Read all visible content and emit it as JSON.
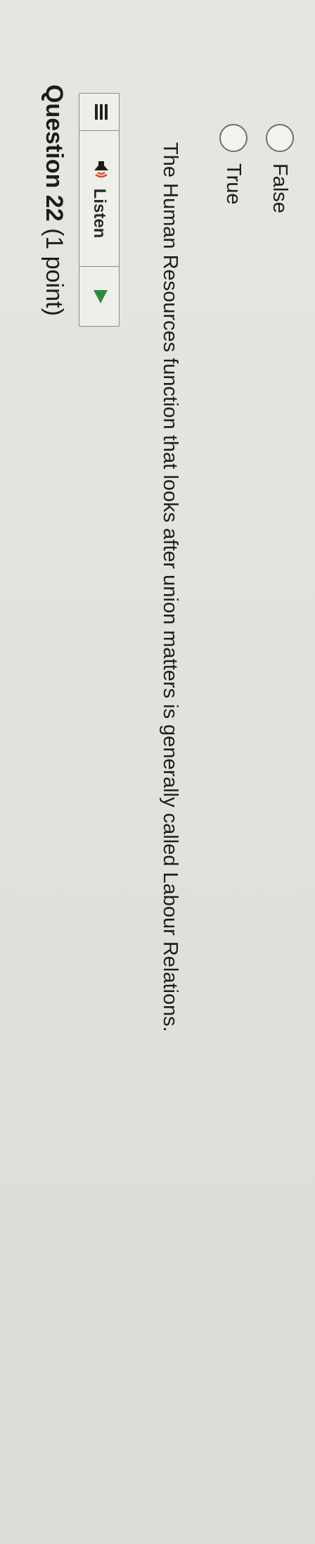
{
  "question": {
    "label": "Question 22",
    "points": "(1 point)",
    "text": "The Human Resources function that looks after union matters is generally called Labour Relations."
  },
  "toolbar": {
    "handle_icon": "grip-lines-icon",
    "listen_icon": "speaker-icon",
    "listen_label": "Listen",
    "play_icon": "play-icon",
    "play_color": "#2e8b3a"
  },
  "options": [
    {
      "label": "True",
      "selected": false
    },
    {
      "label": "False",
      "selected": false
    }
  ]
}
